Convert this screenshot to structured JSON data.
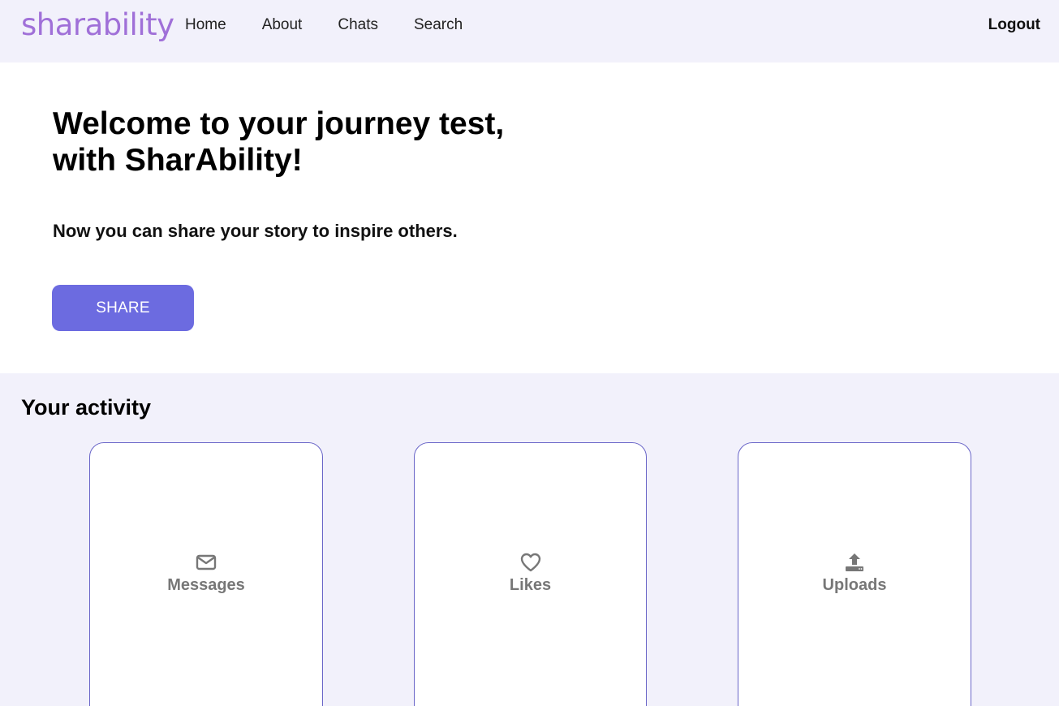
{
  "header": {
    "logo": "sharability",
    "nav": [
      "Home",
      "About",
      "Chats",
      "Search"
    ],
    "logout": "Logout"
  },
  "hero": {
    "title_line1": "Welcome to your journey test,",
    "title_line2": "with SharAbility!",
    "subtitle": "Now you can share your story to inspire others.",
    "share_label": "SHARE"
  },
  "activity": {
    "title": "Your activity",
    "cards": [
      {
        "label": "Messages",
        "icon": "envelope-icon"
      },
      {
        "label": "Likes",
        "icon": "heart-icon"
      },
      {
        "label": "Uploads",
        "icon": "upload-icon"
      }
    ]
  },
  "colors": {
    "brand": "#a070d8",
    "button": "#6c6be0",
    "band": "#f2f1fb",
    "card_border": "#6a66c8",
    "muted": "#777777"
  }
}
